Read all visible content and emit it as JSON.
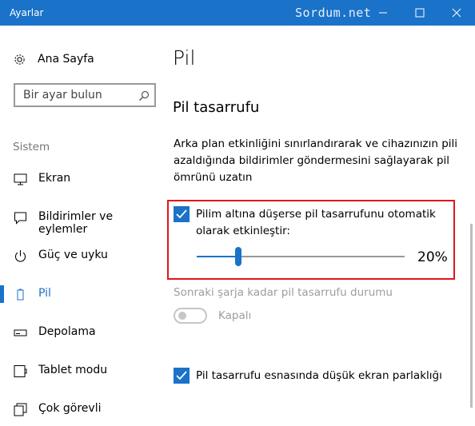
{
  "window": {
    "title": "Ayarlar",
    "watermark": "Sordum.net",
    "accent": "#1a72c9",
    "highlight_box_color": "#e0141e"
  },
  "sidebar": {
    "home_label": "Ana Sayfa",
    "search_placeholder": "Bir ayar bulun",
    "section_label": "Sistem",
    "items": [
      {
        "label": "Ekran",
        "icon": "monitor-icon"
      },
      {
        "label": "Bildirimler ve eylemler",
        "icon": "notification-icon"
      },
      {
        "label": "Güç ve uyku",
        "icon": "power-icon"
      },
      {
        "label": "Pil",
        "icon": "battery-icon",
        "active": true
      },
      {
        "label": "Depolama",
        "icon": "storage-icon"
      },
      {
        "label": "Tablet modu",
        "icon": "tablet-icon"
      },
      {
        "label": "Çok görevli",
        "icon": "multitask-icon"
      }
    ]
  },
  "main": {
    "title": "Pil",
    "subtitle": "Pil tasarrufu",
    "description": "Arka plan etkinliğini sınırlandırarak ve cihazınızın pili azaldığında bildirimler göndermesini sağlayarak pil ömrünü uzatın",
    "auto_saver": {
      "checked": true,
      "label": "Pilim altına düşerse pil tasarrufunu otomatik olarak etkinleştir:",
      "slider_value": 20,
      "slider_display": "20%"
    },
    "status_label": "Sonraki şarja kadar pil tasarrufu durumu",
    "toggle": {
      "on": false,
      "label": "Kapalı"
    },
    "lower_brightness": {
      "checked": true,
      "label": "Pil tasarrufu esnasında düşük ekran parlaklığı"
    }
  }
}
